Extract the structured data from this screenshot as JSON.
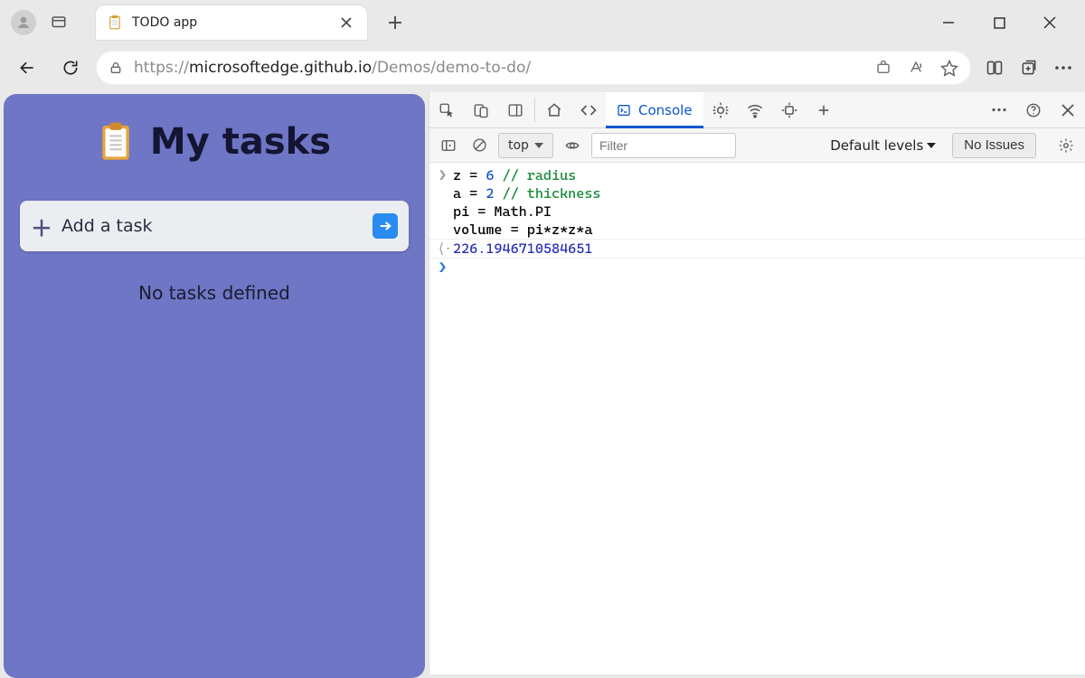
{
  "browser": {
    "tab_title": "TODO app",
    "url_prefix": "https://",
    "url_host": "microsoftedge.github.io",
    "url_path": "/Demos/demo-to-do/"
  },
  "page": {
    "title": "My tasks",
    "add_placeholder": "Add a task",
    "empty_state": "No tasks defined"
  },
  "devtools": {
    "active_tab": "Console",
    "context": "top",
    "filter_placeholder": "Filter",
    "levels_label": "Default levels",
    "issues_label": "No Issues",
    "console": {
      "input_lines": [
        {
          "prefix": "z = ",
          "num": "6",
          "rest": "",
          "comment": " // radius"
        },
        {
          "prefix": "a = ",
          "num": "2",
          "rest": "",
          "comment": " // thickness"
        },
        {
          "prefix": "pi = ",
          "num": "",
          "rest": "Math.PI",
          "comment": ""
        },
        {
          "prefix": "volume = ",
          "num": "",
          "rest": "pi*z*z*a",
          "comment": ""
        }
      ],
      "output": "226.1946710584651"
    }
  }
}
